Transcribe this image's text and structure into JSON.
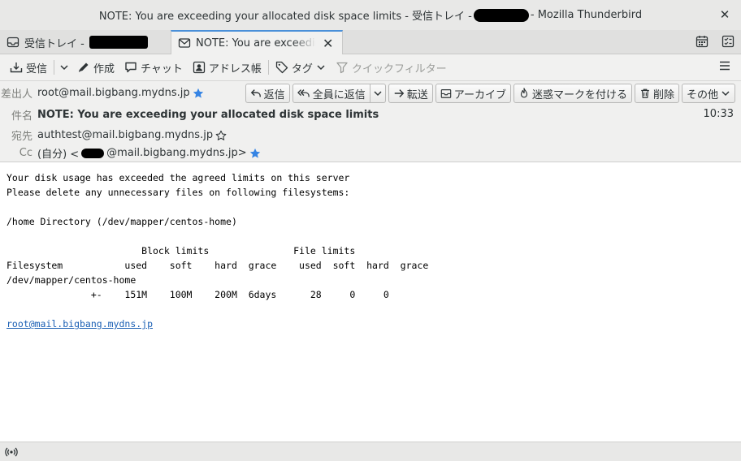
{
  "window": {
    "title_prefix": "NOTE: You are exceeding your allocated disk space limits - 受信トレイ -",
    "title_suffix": "- Mozilla Thunderbird",
    "close_icon": "close-icon"
  },
  "tabs": [
    {
      "label": "受信トレイ -",
      "icon": "inbox-icon",
      "active": false
    },
    {
      "label": "NOTE: You are exceeding",
      "icon": "envelope-icon",
      "active": true
    }
  ],
  "toolbar": {
    "get_mail": "受信",
    "write": "作成",
    "chat": "チャット",
    "address_book": "アドレス帳",
    "tag": "タグ",
    "quick_filter": "クイックフィルター"
  },
  "header": {
    "from_label": "差出人",
    "from_value": "root@mail.bigbang.mydns.jp",
    "subject_label": "件名",
    "subject_value": "NOTE: You are exceeding your allocated disk space limits",
    "to_label": "宛先",
    "to_value": "authtest@mail.bigbang.mydns.jp",
    "cc_label": "Cc",
    "cc_prefix": "(自分) <",
    "cc_suffix": "@mail.bigbang.mydns.jp>",
    "time": "10:33",
    "actions": {
      "reply": "返信",
      "reply_all": "全員に返信",
      "forward": "転送",
      "archive": "アーカイブ",
      "junk": "迷惑マークを付ける",
      "delete": "削除",
      "other": "その他"
    }
  },
  "message": {
    "lines": [
      "Your disk usage has exceeded the agreed limits on this server",
      "Please delete any unnecessary files on following filesystems:",
      "",
      "/home Directory (/dev/mapper/centos-home)",
      "",
      "                        Block limits               File limits",
      "Filesystem           used    soft    hard  grace    used  soft  hard  grace",
      "/dev/mapper/centos-home",
      "               +-    151M    100M    200M  6days      28     0     0",
      ""
    ],
    "link": "root@mail.bigbang.mydns.jp"
  },
  "colors": {
    "accent": "#4a90d9",
    "star": "#3584e4",
    "link": "#1a5fb4"
  }
}
